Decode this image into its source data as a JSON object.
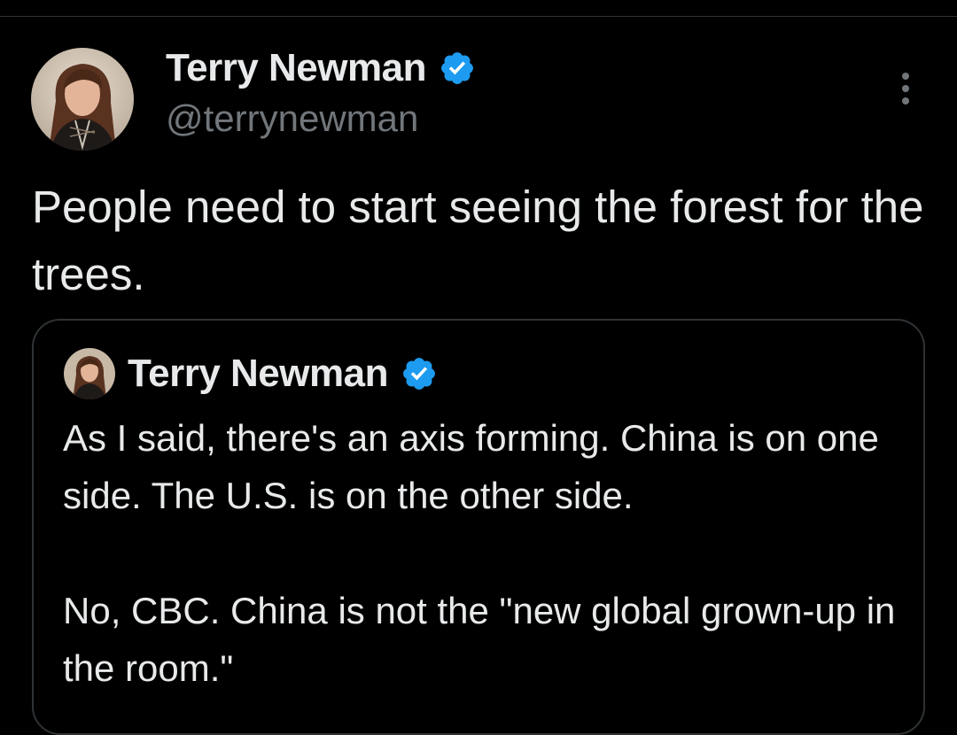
{
  "tweet": {
    "author": {
      "display_name": "Terry Newman",
      "handle": "@terrynewman",
      "verified": true
    },
    "text": "People need to start seeing the forest for the trees.",
    "quoted_tweet": {
      "author": {
        "display_name": "Terry Newman",
        "verified": true
      },
      "paragraphs": [
        "As I said, there's an axis forming. China is on one side. The U.S. is on the other side.",
        "No, CBC. China is not the \"new global grown-up in the room.\""
      ]
    }
  },
  "icons": {
    "verified": "verified-badge-icon",
    "more": "more-options-icon"
  },
  "colors": {
    "background": "#000000",
    "text_primary": "#e7e9ea",
    "text_secondary": "#71767b",
    "verified_blue": "#1d9bf0",
    "border": "#2f3336"
  }
}
